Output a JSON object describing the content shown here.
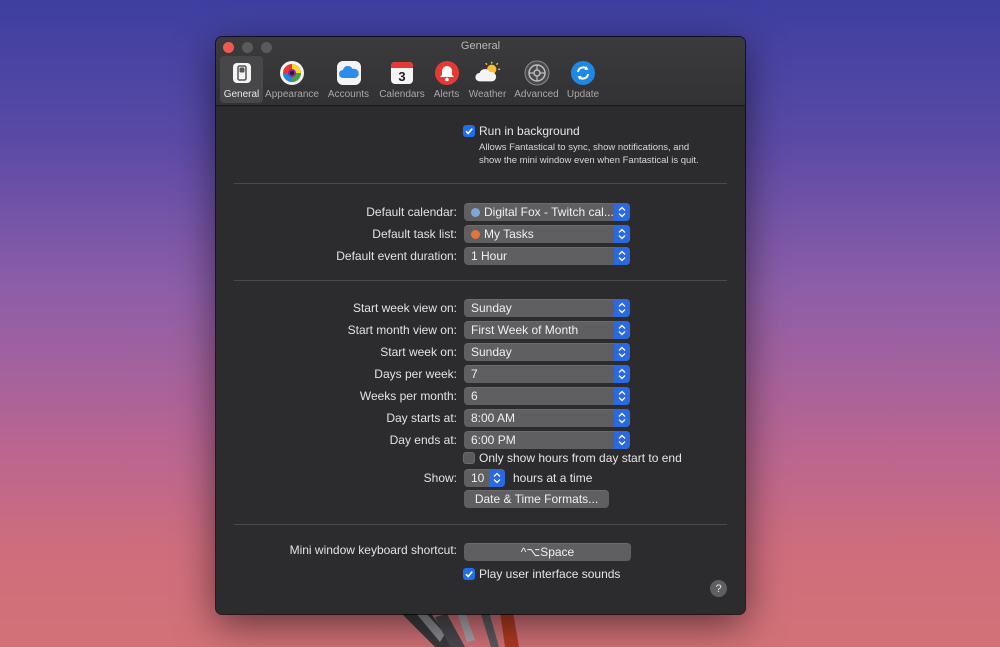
{
  "window": {
    "title": "General"
  },
  "toolbar": [
    {
      "label": "General",
      "icon": "general-switch-icon",
      "active": true
    },
    {
      "label": "Appearance",
      "icon": "appearance-icon"
    },
    {
      "label": "Accounts",
      "icon": "cloud-icon"
    },
    {
      "label": "Calendars",
      "icon": "calendar-icon",
      "badge": "3"
    },
    {
      "label": "Alerts",
      "icon": "bell-icon"
    },
    {
      "label": "Weather",
      "icon": "weather-icon"
    },
    {
      "label": "Advanced",
      "icon": "gear-icon"
    },
    {
      "label": "Update",
      "icon": "refresh-icon"
    }
  ],
  "general": {
    "run_background_label": "Run in background",
    "run_background_checked": true,
    "run_background_note_1": "Allows Fantastical to sync, show notifications, and",
    "run_background_note_2": "show the mini window even when Fantastical is quit."
  },
  "defaults": {
    "calendar_label": "Default calendar:",
    "calendar_value": "Digital Fox - Twitch cal...",
    "calendar_color": "#7ea7d8",
    "task_label": "Default task list:",
    "task_value": "My Tasks",
    "task_color": "#e8733a",
    "duration_label": "Default event duration:",
    "duration_value": "1 Hour"
  },
  "view": {
    "week_view_label": "Start week view on:",
    "week_view_value": "Sunday",
    "month_view_label": "Start month view on:",
    "month_view_value": "First Week of Month",
    "week_on_label": "Start week on:",
    "week_on_value": "Sunday",
    "days_label": "Days per week:",
    "days_value": "7",
    "weeks_label": "Weeks per month:",
    "weeks_value": "6",
    "starts_label": "Day starts at:",
    "starts_value": "8:00 AM",
    "ends_label": "Day ends at:",
    "ends_value": "6:00 PM",
    "only_hours_label": "Only show hours from day start to end",
    "only_hours_checked": false,
    "show_label": "Show:",
    "show_value": "10",
    "show_suffix": "hours at a time",
    "formats_button": "Date & Time Formats..."
  },
  "shortcut": {
    "label": "Mini window keyboard shortcut:",
    "value": "^⌥Space",
    "sounds_label": "Play user interface sounds",
    "sounds_checked": true
  },
  "help": {
    "label": "?"
  },
  "colors": {
    "accent": "#2a69df",
    "close": "#ee5a52"
  }
}
